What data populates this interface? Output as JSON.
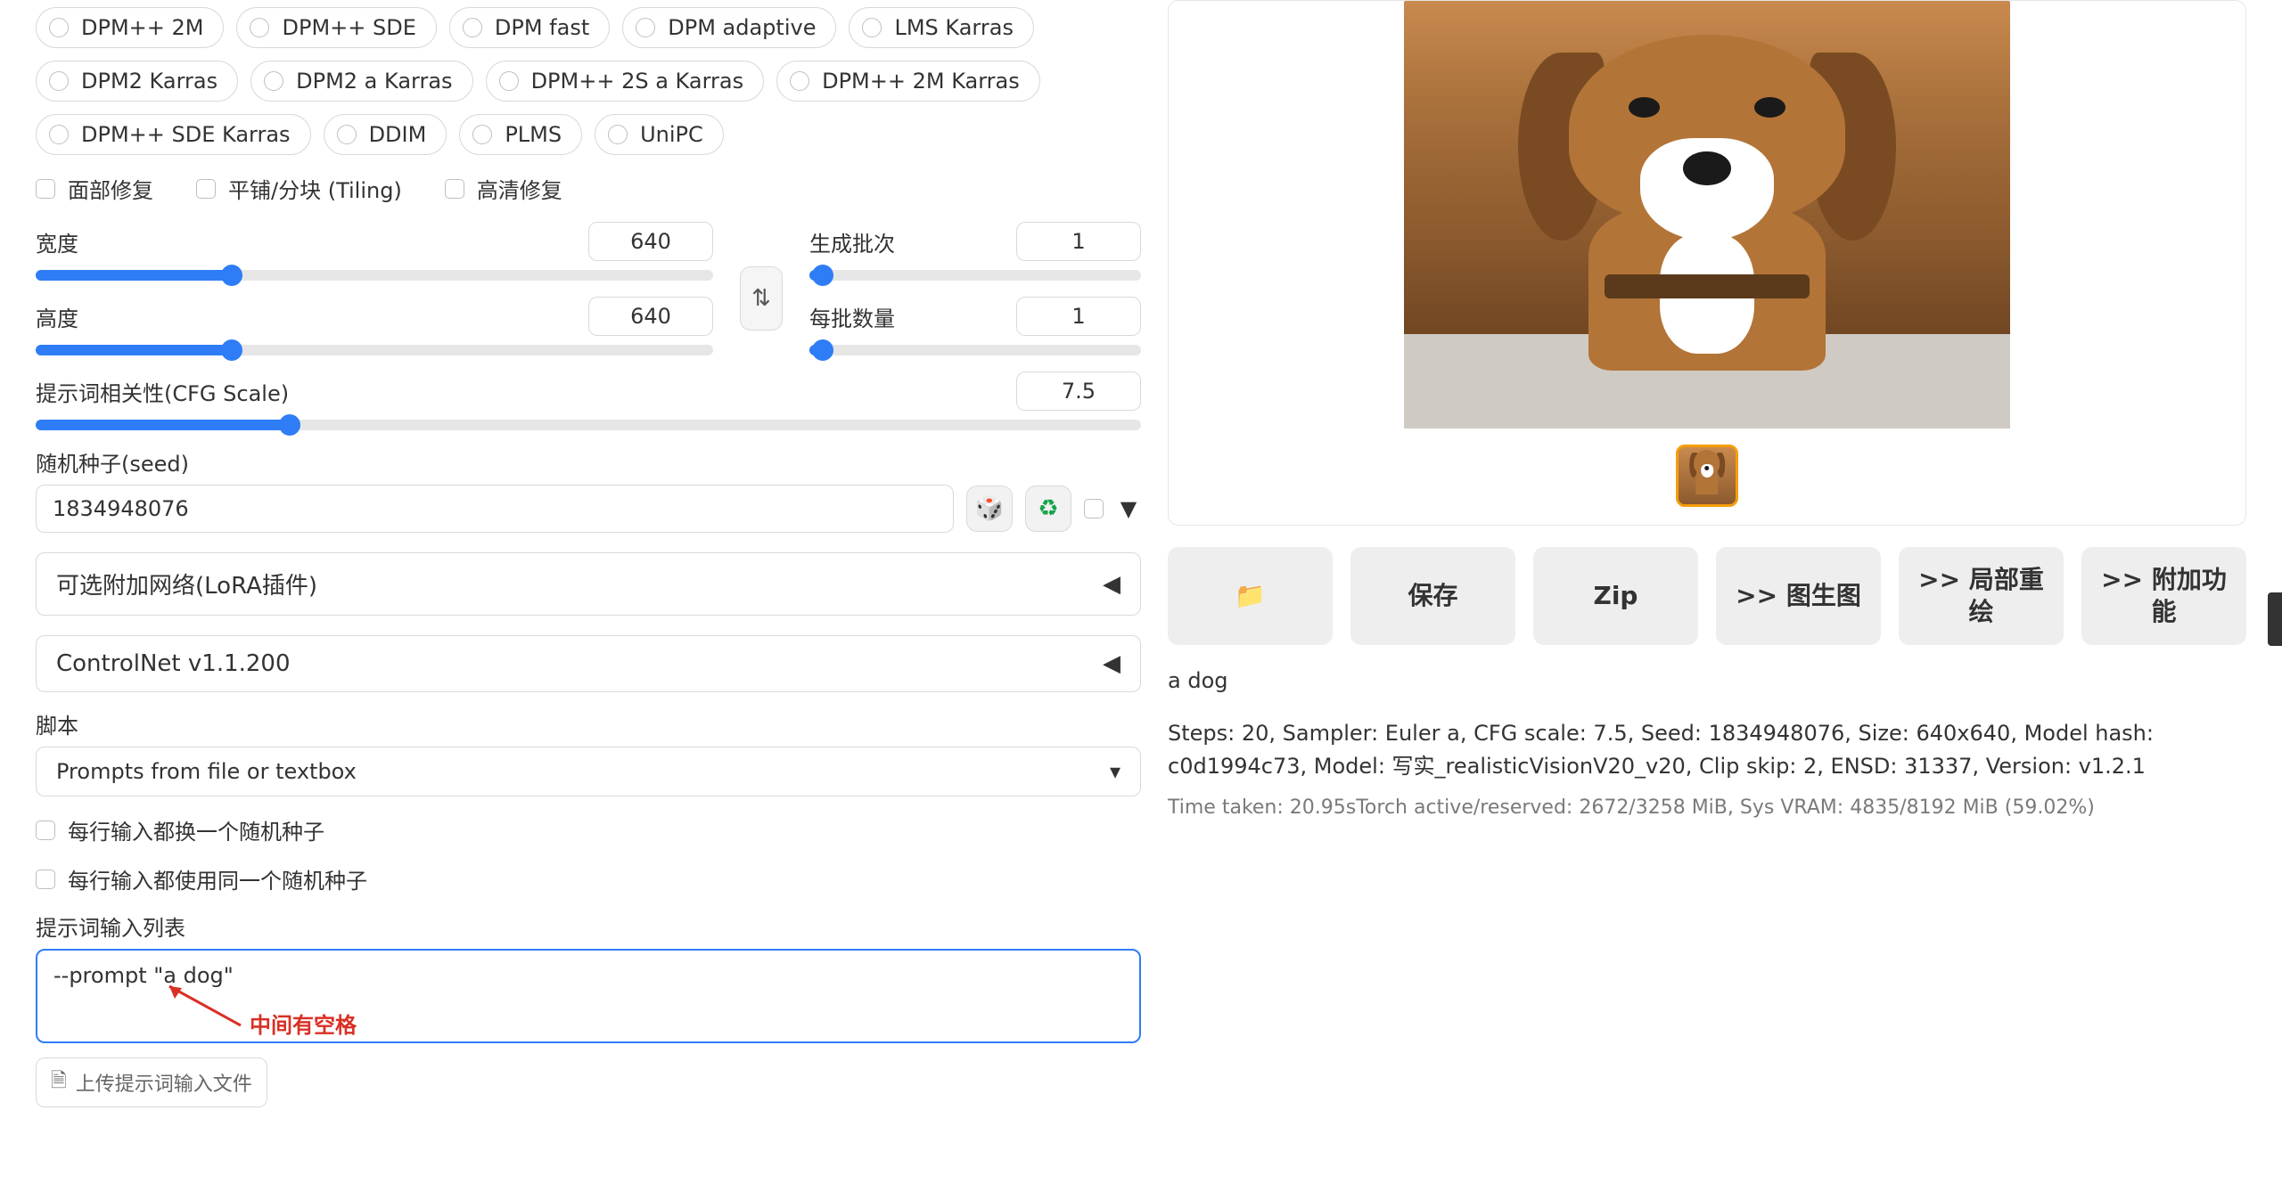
{
  "samplers": [
    "DPM++ 2M",
    "DPM++ SDE",
    "DPM fast",
    "DPM adaptive",
    "LMS Karras",
    "DPM2 Karras",
    "DPM2 a Karras",
    "DPM++ 2S a Karras",
    "DPM++ 2M Karras",
    "DPM++ SDE Karras",
    "DDIM",
    "PLMS",
    "UniPC"
  ],
  "checks": {
    "face": "面部修复",
    "tiling": "平铺/分块 (Tiling)",
    "hires": "高清修复"
  },
  "dims": {
    "width_label": "宽度",
    "width": "640",
    "height_label": "高度",
    "height": "640"
  },
  "batch": {
    "count_label": "生成批次",
    "count": "1",
    "size_label": "每批数量",
    "size": "1"
  },
  "cfg": {
    "label": "提示词相关性(CFG Scale)",
    "value": "7.5"
  },
  "seed": {
    "label": "随机种子(seed)",
    "value": "1834948076"
  },
  "accordions": {
    "lora": "可选附加网络(LoRA插件)",
    "controlnet": "ControlNet v1.1.200"
  },
  "script": {
    "label": "脚本",
    "value": "Prompts from file or textbox"
  },
  "script_opts": {
    "iterate": "每行输入都换一个随机种子",
    "same": "每行输入都使用同一个随机种子",
    "list_label": "提示词输入列表",
    "text": "--prompt \"a dog\"",
    "upload": "上传提示词输入文件"
  },
  "annotation": "中间有空格",
  "actions": {
    "folder": "📁",
    "save": "保存",
    "zip": "Zip",
    "img2img": ">> 图生图",
    "inpaint": ">> 局部重绘",
    "extras": ">> 附加功能"
  },
  "result": {
    "prompt": "a dog",
    "params": "Steps: 20, Sampler: Euler a, CFG scale: 7.5, Seed: 1834948076, Size: 640x640, Model hash: c0d1994c73, Model: 写实_realisticVisionV20_v20, Clip skip: 2, ENSD: 31337, Version: v1.2.1",
    "timing": "Time taken: 20.95sTorch active/reserved: 2672/3258 MiB, Sys VRAM: 4835/8192 MiB (59.02%)"
  },
  "icons": {
    "swap": "⇅",
    "dice": "🎲",
    "recycle": "♻",
    "tri_left": "◀",
    "tri_down": "▼",
    "caret": "▾",
    "file": "🗎"
  }
}
